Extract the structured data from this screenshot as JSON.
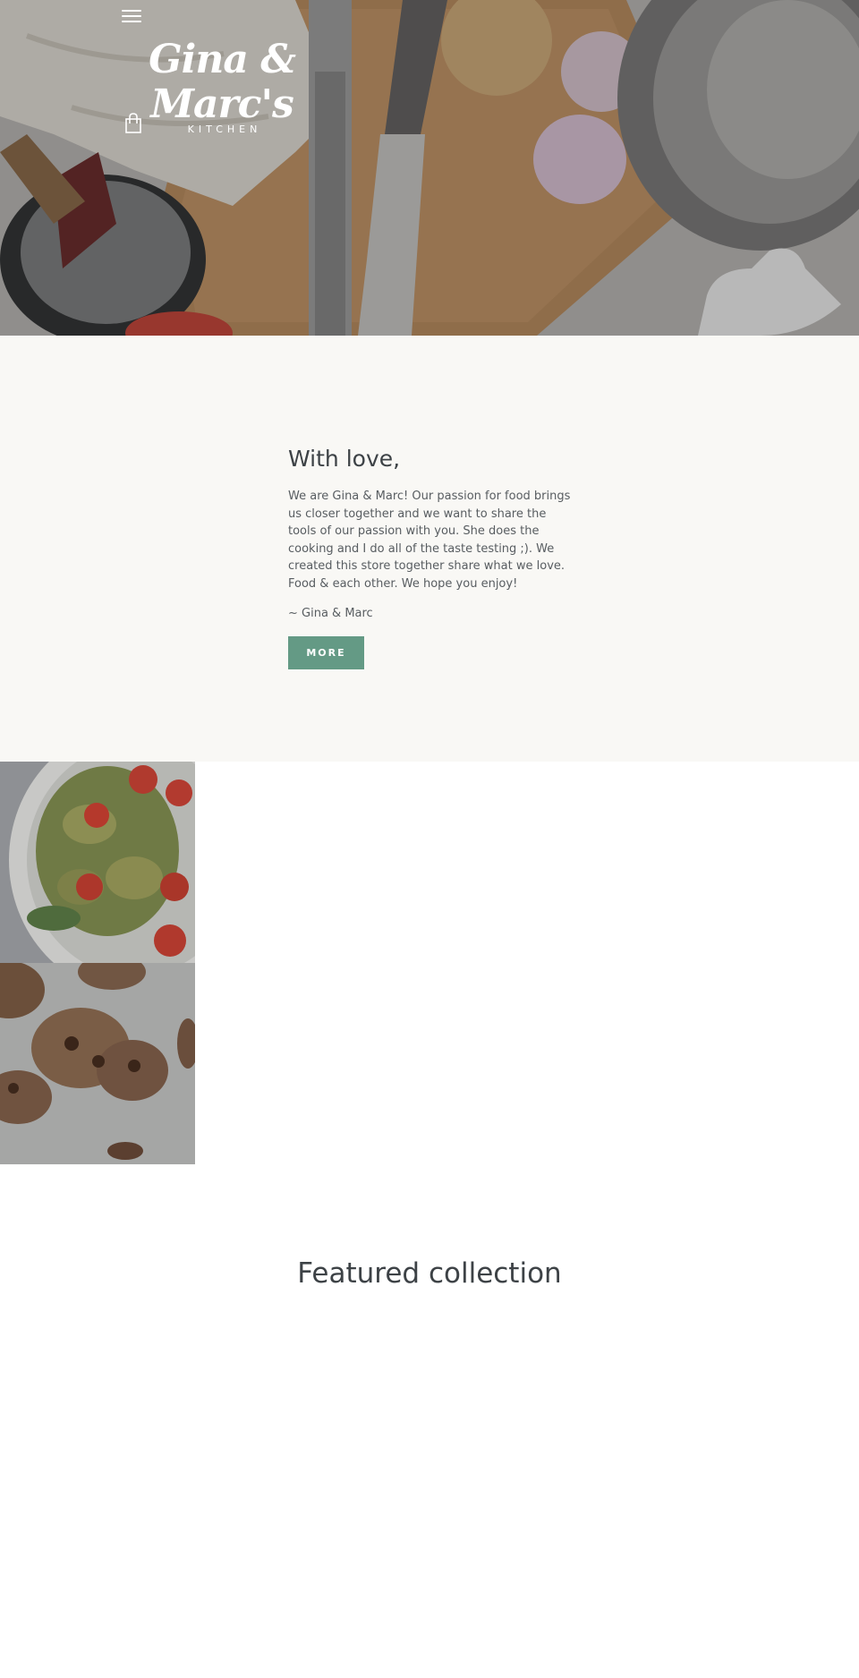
{
  "header": {
    "logo_text": "Gina & Marc's",
    "logo_subtext": "KITCHEN",
    "menu_icon": "hamburger-menu-icon",
    "cart_icon": "shopping-bag-icon"
  },
  "about": {
    "heading": "With love,",
    "body": "We are Gina & Marc! Our passion for food brings us closer together and we want to share the tools of our passion with you. She does the cooking and I do all of the taste testing ;). We created this store together share what we love. Food & each other. We hope you enjoy!",
    "signature": "~ Gina & Marc",
    "button_label": "MORE"
  },
  "featured": {
    "title": "Featured collection"
  },
  "colors": {
    "accent": "#649a85",
    "about_background": "#f9f8f5",
    "text": "#3d4246"
  }
}
